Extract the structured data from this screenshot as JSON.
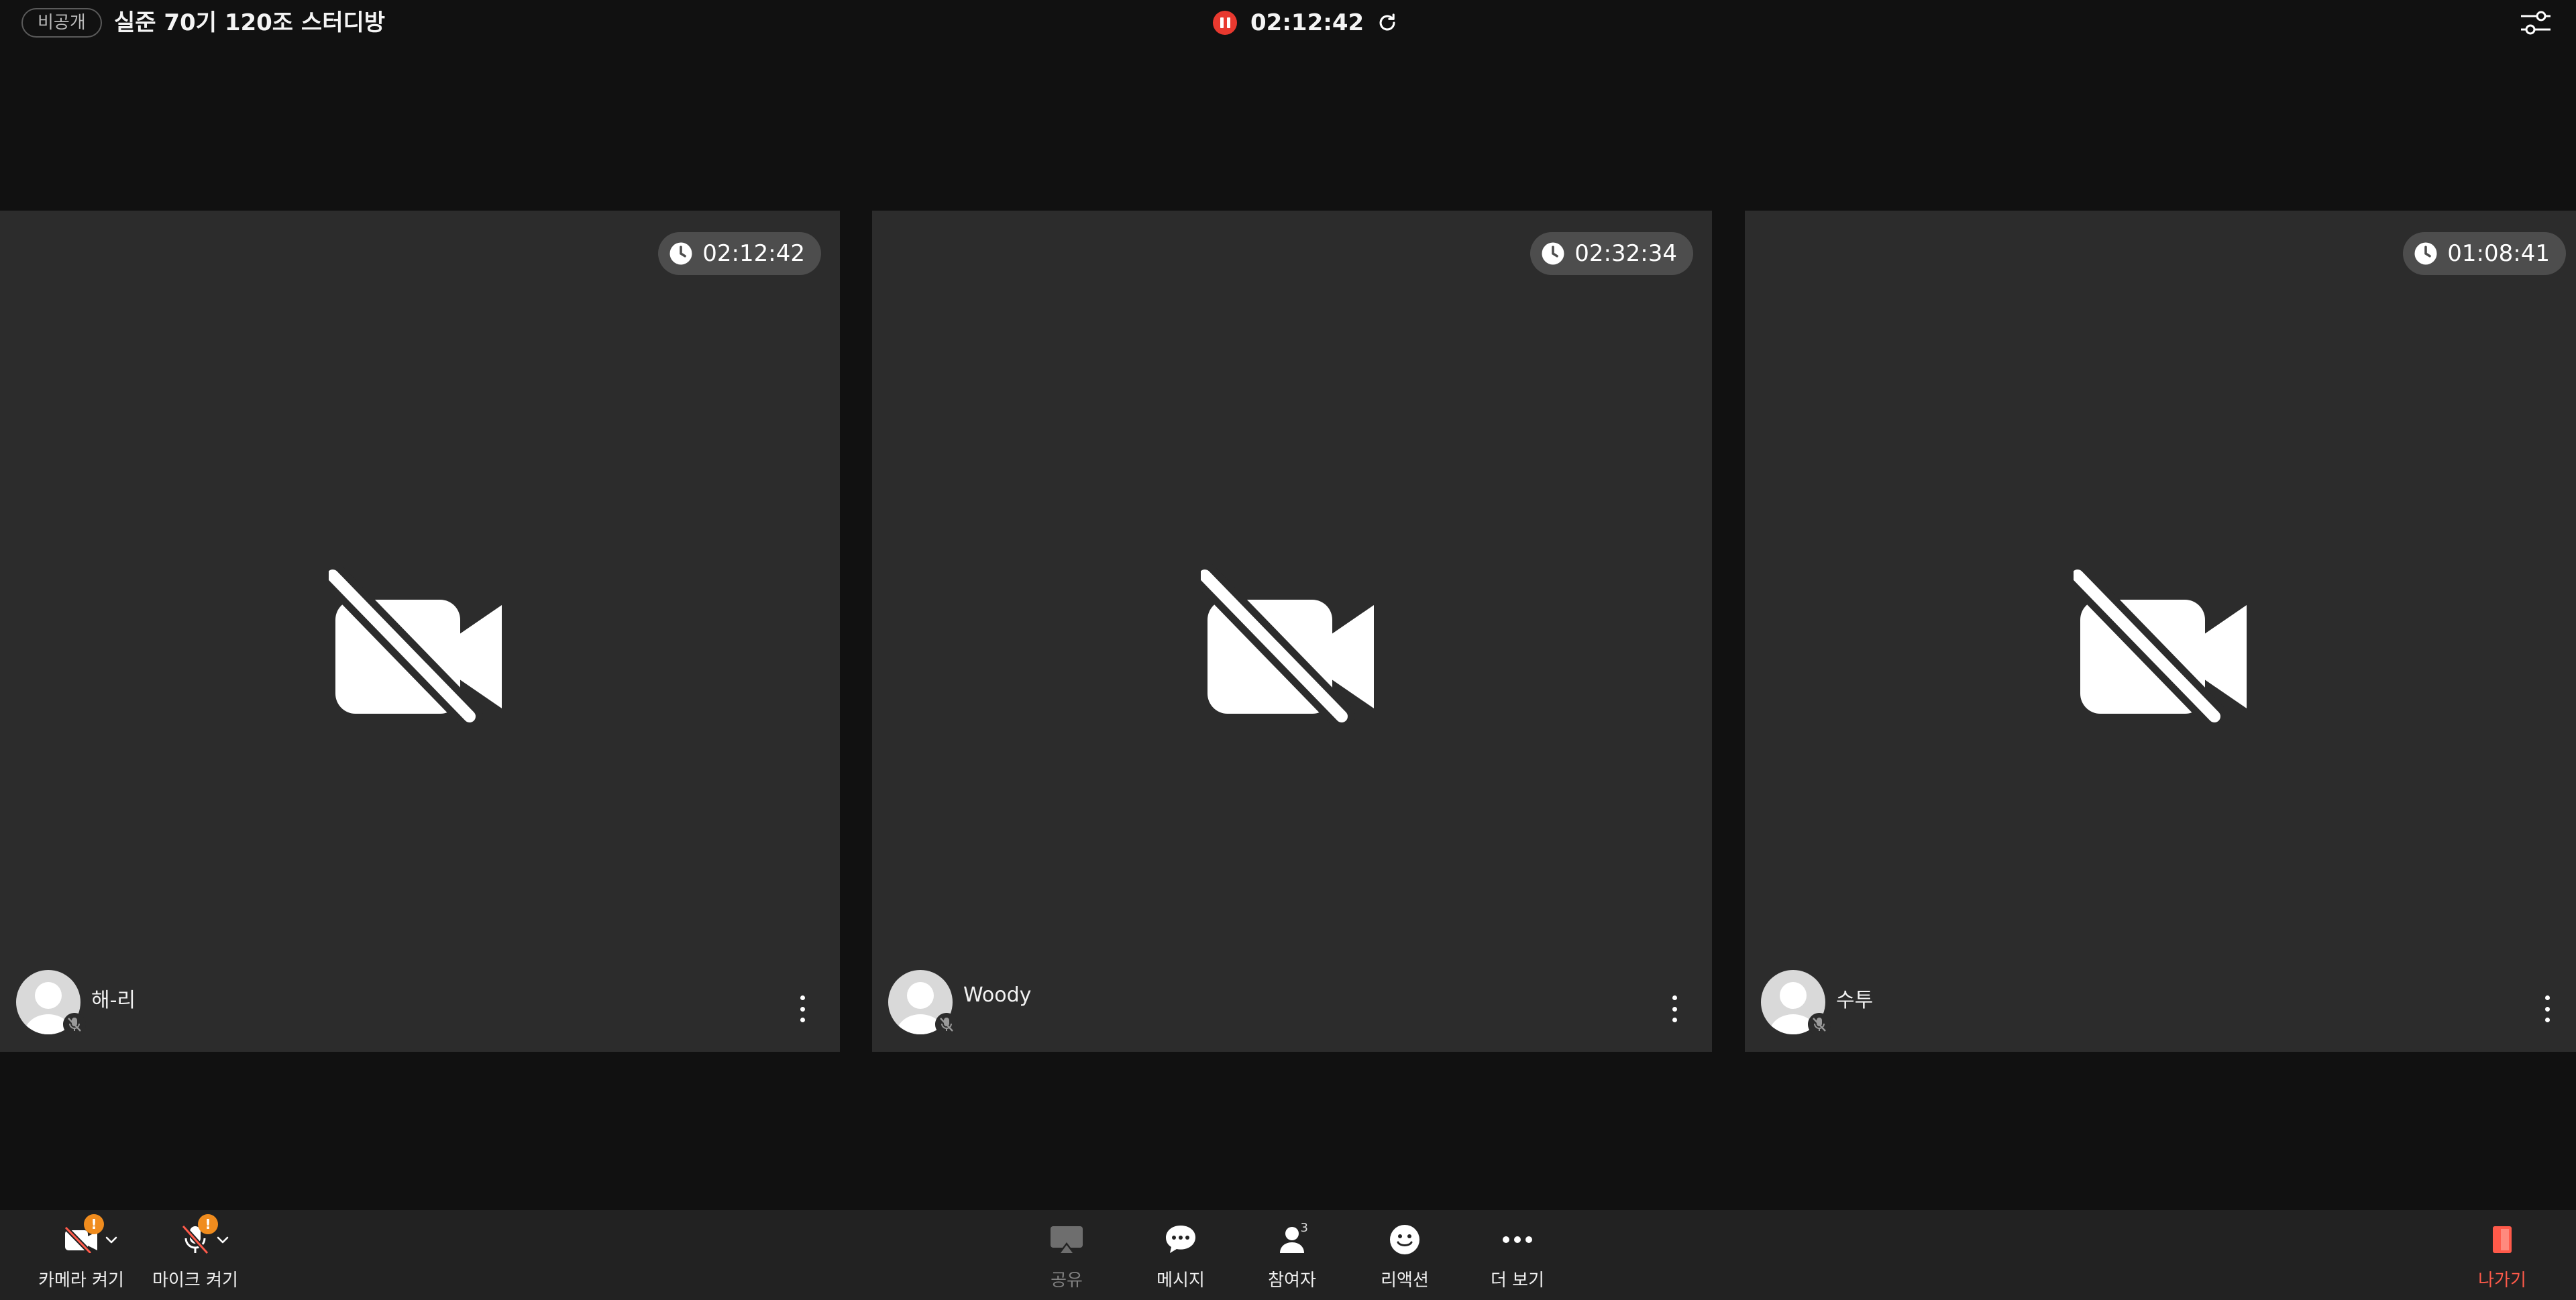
{
  "header": {
    "privacy_badge": "비공개",
    "room_title": "실준 70기 120조 스터디방",
    "recording_time": "02:12:42"
  },
  "tiles": [
    {
      "name": "해-리",
      "timer": "02:12:42"
    },
    {
      "name": "Woody",
      "timer": "02:32:34"
    },
    {
      "name": "수투",
      "timer": "01:08:41"
    }
  ],
  "toolbar": {
    "camera_label": "카메라 켜기",
    "mic_label": "마이크 켜기",
    "warning_glyph": "!",
    "share_label": "공유",
    "message_label": "메시지",
    "participants_label": "참여자",
    "participants_count": "3",
    "reaction_label": "리액션",
    "more_label": "더 보기",
    "exit_label": "나가기"
  },
  "colors": {
    "background": "#111111",
    "tile": "#2c2c2c",
    "toolbar": "#222222",
    "record": "#e8392f",
    "warning": "#f08c1e",
    "exit": "#ff5a4a"
  },
  "icons": {
    "settings": "sliders-icon",
    "recording": "pause-icon",
    "refresh": "refresh-icon",
    "tile_status": "camera-off-icon",
    "tile_timer": "clock-icon"
  }
}
